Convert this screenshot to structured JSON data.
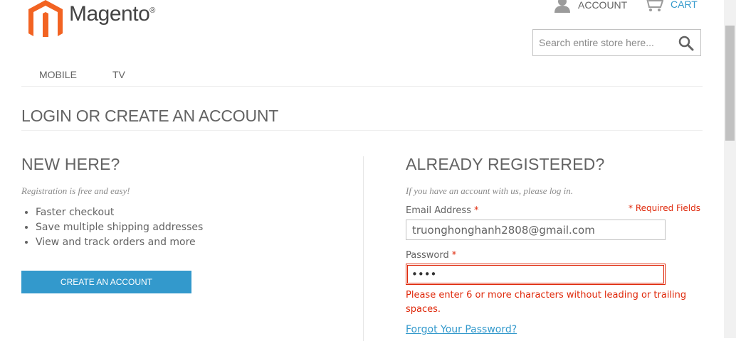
{
  "header": {
    "logo_text": "Magento",
    "logo_reg": "®",
    "account_label": "ACCOUNT",
    "cart_label": "CART",
    "search_placeholder": "Search entire store here..."
  },
  "nav": {
    "items": [
      {
        "label": "MOBILE"
      },
      {
        "label": "TV"
      }
    ]
  },
  "page": {
    "title": "LOGIN OR CREATE AN ACCOUNT"
  },
  "new_customer": {
    "title": "NEW HERE?",
    "subtitle": "Registration is free and easy!",
    "benefits": [
      "Faster checkout",
      "Save multiple shipping addresses",
      "View and track orders and more"
    ],
    "button_label": "CREATE AN ACCOUNT"
  },
  "registered": {
    "title": "ALREADY REGISTERED?",
    "subtitle": "If you have an account with us, please log in.",
    "required_note": "* Required Fields",
    "email_label": "Email Address",
    "email_value": "truonghonghanh2808@gmail.com",
    "password_label": "Password",
    "password_value": "••••",
    "required_star": "*",
    "password_error": "Please enter 6 or more characters without leading or trailing spaces.",
    "forgot_link": "Forgot Your Password?"
  },
  "colors": {
    "accent": "#3399cc",
    "error": "#df280a",
    "text": "#636363",
    "logo_orange": "#f26322"
  },
  "icons": {
    "logo": "magento-logo-icon",
    "account": "user-icon",
    "cart": "cart-icon",
    "search": "search-icon"
  }
}
